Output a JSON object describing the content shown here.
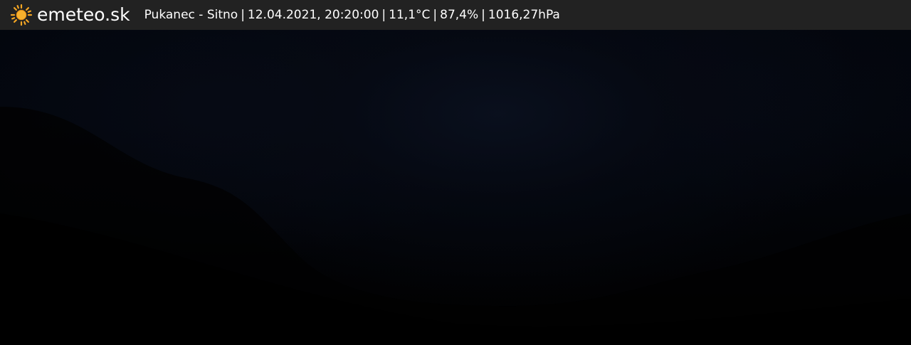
{
  "header": {
    "brand": "emeteo.sk",
    "logo_icon": "sun-icon",
    "logo_color": "#f5a623",
    "location": "Pukanec - Sitno",
    "datetime": "12.04.2021, 20:20:00",
    "temperature": "11,1°C",
    "humidity": "87,4%",
    "pressure": "1016,27hPa",
    "separator": "|"
  },
  "colors": {
    "topbar_bg": "#222222",
    "text": "#ffffff",
    "night_sky": "#03060d"
  }
}
